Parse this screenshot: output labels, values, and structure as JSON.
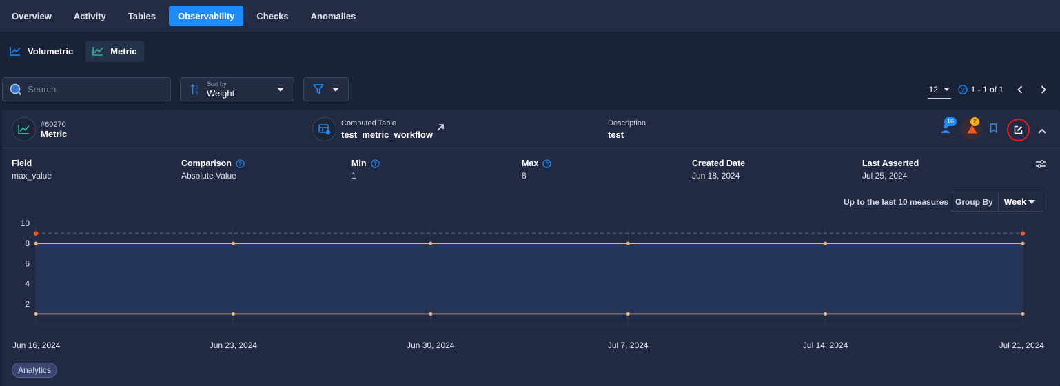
{
  "tabs": [
    "Overview",
    "Activity",
    "Tables",
    "Observability",
    "Checks",
    "Anomalies"
  ],
  "active_tab": "Observability",
  "subtabs": [
    {
      "label": "Volumetric",
      "icon": "line-chart-icon"
    },
    {
      "label": "Metric",
      "icon": "line-chart-icon"
    }
  ],
  "active_subtab": "Metric",
  "search": {
    "placeholder": "Search"
  },
  "sort": {
    "label": "Sort by",
    "value": "Weight"
  },
  "pagination": {
    "per_page": "12",
    "range": "1 - 1 of 1"
  },
  "check": {
    "id": "#60270",
    "type": "Metric",
    "computed_table_label": "Computed Table",
    "computed_table": "test_metric_workflow",
    "description_label": "Description",
    "description": "test",
    "users_count": "16",
    "anomalies_count": "2"
  },
  "properties": {
    "field_label": "Field",
    "field": "max_value",
    "comparison_label": "Comparison",
    "comparison": "Absolute Value",
    "min_label": "Min",
    "min": "1",
    "max_label": "Max",
    "max": "8",
    "created_label": "Created Date",
    "created": "Jun 18, 2024",
    "asserted_label": "Last Asserted",
    "asserted": "Jul 25, 2024"
  },
  "measures_text": "Up to the last 10 measures",
  "group_by": {
    "label": "Group By",
    "value": "Week"
  },
  "tag": "Analytics",
  "colors": {
    "accent": "#1d8cf8",
    "line": "#f0b072",
    "anomaly": "#f05a23",
    "band": "#263a63"
  },
  "chart_data": {
    "type": "line",
    "x": [
      "Jun 16, 2024",
      "Jun 23, 2024",
      "Jun 30, 2024",
      "Jul 7, 2024",
      "Jul 14, 2024",
      "Jul 21, 2024"
    ],
    "yticks": [
      2,
      4,
      6,
      8,
      10
    ],
    "ylim": [
      0,
      10
    ],
    "series": [
      {
        "values": [
          8,
          8,
          8,
          8,
          8,
          8
        ]
      },
      {
        "values": [
          1,
          1,
          1,
          1,
          1,
          1
        ]
      }
    ],
    "threshold": 9,
    "threshold_anomaly_points": [
      0,
      5
    ]
  }
}
